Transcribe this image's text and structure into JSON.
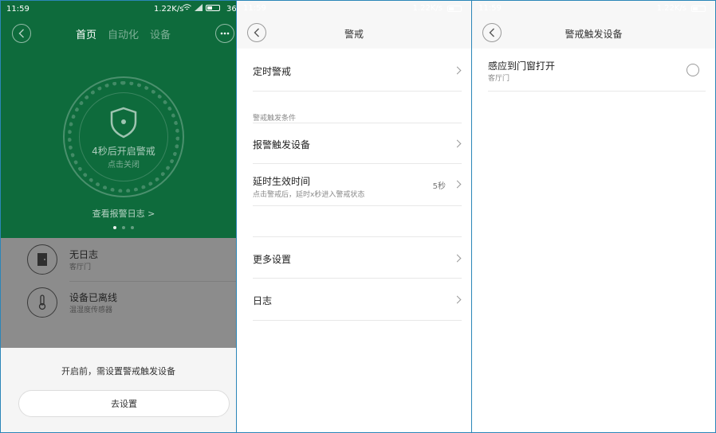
{
  "panel1": {
    "status": {
      "time": "11:59",
      "speed": "1.22K/s",
      "battery": "36%"
    },
    "tabs": [
      "首页",
      "自动化",
      "设备"
    ],
    "active_tab": 0,
    "dial_text": "4秒后开启警戒",
    "dial_sub": "点击关闭",
    "log_link": "查看报警日志 >",
    "devices": [
      {
        "title": "无日志",
        "sub": "客厅门",
        "icon": "door-icon"
      },
      {
        "title": "设备已离线",
        "sub": "温湿度传感器",
        "icon": "thermometer-icon"
      }
    ],
    "sheet_message": "开启前，需设置警戒触发设备",
    "sheet_button": "去设置",
    "colors": {
      "green": "#0e6b3c",
      "dim": "#8c8c8c"
    }
  },
  "panel2": {
    "title": "警戒",
    "rows": {
      "timed": "定时警戒",
      "section": "警戒触发条件",
      "trigger": "报警触发设备",
      "delay_title": "延时生效时间",
      "delay_sub": "点击警戒后，延时x秒进入警戒状态",
      "delay_value": "5秒",
      "more": "更多设置",
      "log": "日志"
    }
  },
  "panel3": {
    "title": "警戒触发设备",
    "item_title": "感应到门窗打开",
    "item_sub": "客厅门"
  }
}
